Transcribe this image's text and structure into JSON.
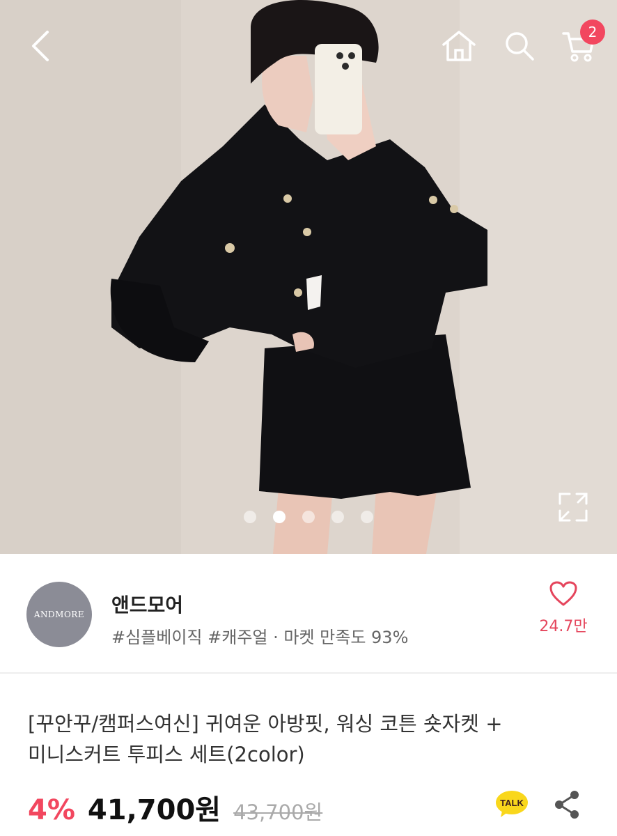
{
  "header": {
    "back_icon": "chevron-left-icon",
    "home_icon": "home-icon",
    "search_icon": "search-icon",
    "cart_icon": "cart-icon",
    "cart_count": "2",
    "badge_color": "#f2475f"
  },
  "gallery": {
    "total_images": 5,
    "active_index": 1,
    "expand_icon": "expand-icon"
  },
  "seller": {
    "logo_text": "ANDMORE",
    "name": "앤드모어",
    "tags": "#심플베이직 #캐주얼 · 마켓 만족도 93%",
    "like_icon": "heart-icon",
    "like_count": "24.7만"
  },
  "product": {
    "title_line1": "[꾸안꾸/캠퍼스여신] 귀여운 아방핏, 워싱 코튼 숏자켓 +",
    "title_line2": "미니스커트 투피스 세트(2color)",
    "discount": "4%",
    "price": "41,700원",
    "original_price": "43,700원",
    "talk_label": "TALK",
    "share_icon": "share-icon",
    "accent_color": "#f2475f"
  }
}
